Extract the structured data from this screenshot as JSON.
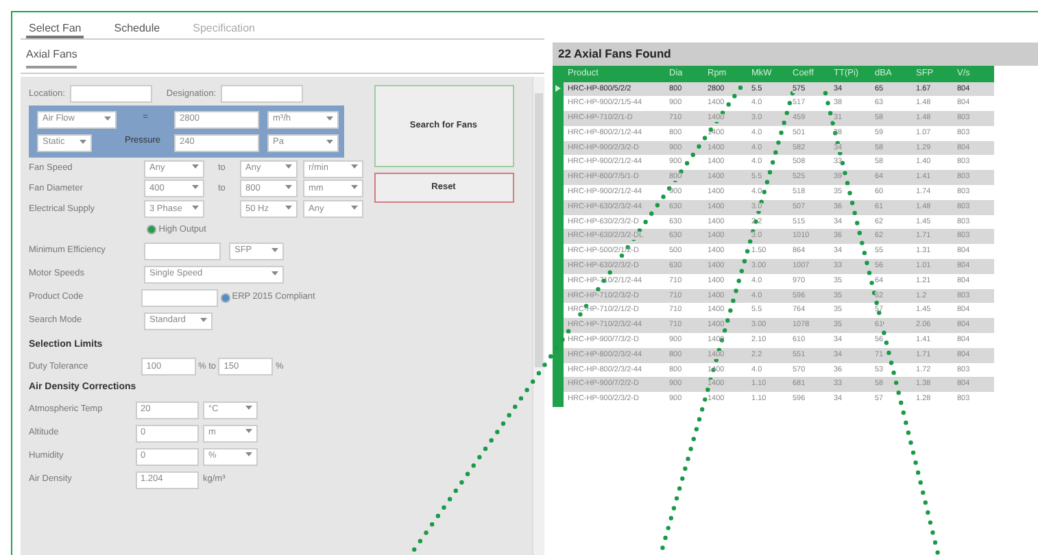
{
  "tabs": [
    {
      "label": "Select Fan",
      "selected": true,
      "disabled": false
    },
    {
      "label": "Schedule",
      "selected": false,
      "disabled": false
    },
    {
      "label": "Specification",
      "selected": false,
      "disabled": true
    }
  ],
  "subtab": {
    "label": "Axial Fans",
    "selected": true
  },
  "form": {
    "location": {
      "label": "Location:"
    },
    "designation": {
      "label": "Designation:"
    },
    "duty": {
      "flow_type": "Air Flow",
      "equals": "=",
      "flow_value": "2800",
      "flow_unit": "m³/h",
      "pressure_type": "Static",
      "pressure_label": "Pressure",
      "pressure_value": "240",
      "pressure_unit": "Pa"
    },
    "fan_speed": {
      "label": "Fan Speed",
      "from": "Any",
      "to_label": "to",
      "to": "Any",
      "unit": "r/min"
    },
    "fan_diameter": {
      "label": "Fan Diameter",
      "from": "400",
      "to_label": "to",
      "to": "800",
      "unit": "mm"
    },
    "electrical_supply": {
      "label": "Electrical Supply",
      "phase": "3 Phase",
      "frequency": "50 Hz",
      "voltage": "Any"
    },
    "high_output": {
      "label": "High Output",
      "checked": true
    },
    "minimum_efficiency": {
      "label": "Minimum Efficiency",
      "unit": "SFP"
    },
    "motor_speeds": {
      "label": "Motor Speeds",
      "value": "Single Speed"
    },
    "product_code": {
      "label": "Product Code"
    },
    "erp_compliant": {
      "label": "ERP 2015 Compliant",
      "checked": true
    },
    "search_mode": {
      "label": "Search Mode",
      "value": "Standard"
    }
  },
  "buttons": [
    {
      "label": "Search for Fans",
      "kind": "primary"
    },
    {
      "label": "Reset",
      "kind": "danger"
    }
  ],
  "selection_limits": {
    "title": "Selection Limits",
    "duty_tolerance": {
      "label": "Duty Tolerance",
      "from": "100",
      "to_label": "% to",
      "to": "150",
      "unit": "%"
    }
  },
  "air_density": {
    "title": "Air Density Corrections",
    "rows": [
      {
        "label": "Atmospheric Temp",
        "value": "20",
        "unit": "°C",
        "kind": "select"
      },
      {
        "label": "Altitude",
        "value": "0",
        "unit": "m",
        "kind": "select"
      },
      {
        "label": "Humidity",
        "value": "0",
        "unit": "%",
        "kind": "select"
      },
      {
        "label": "Air Density",
        "value": "1.204",
        "unit": "kg/m³",
        "kind": "text"
      }
    ]
  },
  "results": {
    "title": "22 Axial Fans Found",
    "columns": [
      "Product",
      "Dia",
      "Rpm",
      "MkW",
      "Coeff",
      "TT(Pi)",
      "dBA",
      "SFP",
      "V/s"
    ],
    "rows": [
      {
        "selected": true,
        "cells": [
          "HRC-HP-800/5/2/2",
          "800",
          "2800",
          "5.5",
          "575",
          "34",
          "65",
          "1.67",
          "804"
        ]
      },
      {
        "selected": false,
        "cells": [
          "HRC-HP-900/2/1/5-44",
          "900",
          "1400",
          "4.0",
          "517",
          "38",
          "63",
          "1.48",
          "804"
        ]
      },
      {
        "selected": false,
        "cells": [
          "HRC-HP-710/2/1-D",
          "710",
          "1400",
          "3.0",
          "459",
          "31",
          "58",
          "1.48",
          "803"
        ]
      },
      {
        "selected": false,
        "cells": [
          "HRC-HP-800/2/1/2-44",
          "800",
          "1400",
          "4.0",
          "501",
          "38",
          "59",
          "1.07",
          "803"
        ]
      },
      {
        "selected": false,
        "cells": [
          "HRC-HP-900/2/3/2-D",
          "900",
          "1400",
          "4.0",
          "582",
          "34",
          "58",
          "1.29",
          "804"
        ]
      },
      {
        "selected": false,
        "cells": [
          "HRC-HP-900/2/1/2-44",
          "900",
          "1400",
          "4.0",
          "508",
          "33",
          "58",
          "1.40",
          "803"
        ]
      },
      {
        "selected": false,
        "cells": [
          "HRC-HP-800/7/5/1-D",
          "800",
          "1400",
          "5.5",
          "525",
          "39",
          "64",
          "1.41",
          "803"
        ]
      },
      {
        "selected": false,
        "cells": [
          "HRC-HP-900/2/1/2-44",
          "900",
          "1400",
          "4.0",
          "518",
          "35",
          "60",
          "1.74",
          "803"
        ]
      },
      {
        "selected": false,
        "cells": [
          "HRC-HP-630/2/3/2-44",
          "630",
          "1400",
          "3.0",
          "507",
          "36",
          "61",
          "1.48",
          "803"
        ]
      },
      {
        "selected": false,
        "cells": [
          "HRC-HP-630/2/3/2-D",
          "630",
          "1400",
          "2.2",
          "515",
          "34",
          "62",
          "1.45",
          "803"
        ]
      },
      {
        "selected": false,
        "cells": [
          "HRC-HP-630/2/3/2-DL",
          "630",
          "1400",
          "3.0",
          "1010",
          "36",
          "62",
          "1.71",
          "803"
        ]
      },
      {
        "selected": false,
        "cells": [
          "HRC-HP-500/2/1/2-D",
          "500",
          "1400",
          "1.50",
          "864",
          "34",
          "55",
          "1.31",
          "804"
        ]
      },
      {
        "selected": false,
        "cells": [
          "HRC-HP-630/2/3/2-D",
          "630",
          "1400",
          "3.00",
          "1007",
          "33",
          "56",
          "1.01",
          "804"
        ]
      },
      {
        "selected": false,
        "cells": [
          "HRC-HP-710/2/1/2-44",
          "710",
          "1400",
          "4.0",
          "970",
          "35",
          "64",
          "1.21",
          "804"
        ]
      },
      {
        "selected": false,
        "cells": [
          "HRC-HP-710/2/3/2-D",
          "710",
          "1400",
          "4.0",
          "596",
          "35",
          "62",
          "1.2",
          "803"
        ]
      },
      {
        "selected": false,
        "cells": [
          "HRC-HP-710/2/1/2-D",
          "710",
          "1400",
          "5.5",
          "764",
          "35",
          "57",
          "1.45",
          "804"
        ]
      },
      {
        "selected": false,
        "cells": [
          "HRC-HP-710/2/3/2-44",
          "710",
          "1400",
          "3.00",
          "1078",
          "35",
          "61",
          "2.06",
          "804"
        ]
      },
      {
        "selected": false,
        "cells": [
          "HRC-HP-900/7/3/2-D",
          "900",
          "1400",
          "2.10",
          "610",
          "34",
          "56",
          "1.41",
          "804"
        ]
      },
      {
        "selected": false,
        "cells": [
          "HRC-HP-800/2/3/2-44",
          "800",
          "1400",
          "2.2",
          "551",
          "34",
          "71",
          "1.71",
          "804"
        ]
      },
      {
        "selected": false,
        "cells": [
          "HRC-HP-800/2/3/2-44",
          "800",
          "1400",
          "4.0",
          "570",
          "36",
          "53",
          "1.72",
          "803"
        ]
      },
      {
        "selected": false,
        "cells": [
          "HRC-HP-900/7/2/2-D",
          "900",
          "1400",
          "1.10",
          "681",
          "33",
          "58",
          "1.38",
          "804"
        ]
      },
      {
        "selected": false,
        "cells": [
          "HRC-HP-900/2/3/2-D",
          "900",
          "1400",
          "1.10",
          "596",
          "34",
          "57",
          "1.28",
          "803"
        ]
      }
    ]
  }
}
